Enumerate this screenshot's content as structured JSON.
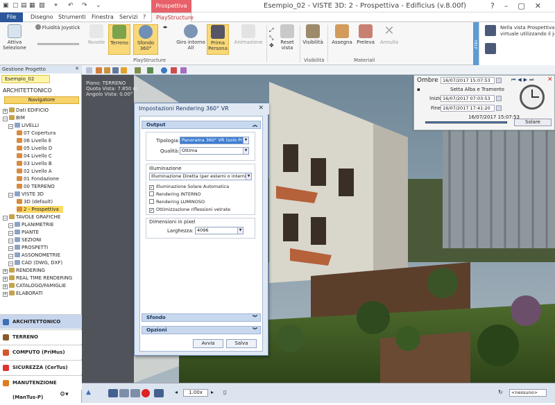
{
  "window": {
    "title": "Esempio_02 -  VISTE 3D: 2 - Prospettiva - Edificius (v.8.00f)",
    "context_tab": "Prospettiva"
  },
  "menu": {
    "tabs": [
      "File",
      "Disegno",
      "Strumenti",
      "Finestra",
      "Servizi",
      "?",
      "PlayStructure"
    ]
  },
  "ribbon": {
    "attiva_selezione": "Attiva Selezione",
    "fluidita": "Fluidità Joystick",
    "nuvole": "Nuvole",
    "terreno": "Terreno",
    "sfondo": "Sfondo 360°",
    "giro": "Giro intorno All",
    "prima_persona": "Prima Persona",
    "animazione": "Animazione",
    "reset_vista": "Reset vista",
    "visibilita": "Visibilità",
    "assegna": "Assegna",
    "preleva": "Preleva",
    "annulla": "Annulla",
    "group_play": "PlayStructure",
    "group_visibilita": "Visibilità",
    "group_materiali": "Materiali",
    "help_strip": "HELP",
    "help_text_1": "Nella vista Prospettiva (P",
    "help_text_2": "virtuale utilizzando il joystic"
  },
  "left_panel": {
    "header": "Gestione Progetto",
    "project_tab": "Esempio_02",
    "section_title": "ARCHITETTONICO",
    "navigator_button": "Navigatore",
    "tree": [
      {
        "label": "Dati EDIFICIO",
        "level": 0
      },
      {
        "label": "BIM",
        "level": 0
      },
      {
        "label": "LIVELLI",
        "level": 1
      },
      {
        "label": "07 Copertura",
        "level": 2
      },
      {
        "label": "06 Livello E",
        "level": 2
      },
      {
        "label": "05 Livello D",
        "level": 2
      },
      {
        "label": "04 Livello C",
        "level": 2
      },
      {
        "label": "03 Livello B",
        "level": 2
      },
      {
        "label": "02 Livello A",
        "level": 2
      },
      {
        "label": "01 Fondazione",
        "level": 2
      },
      {
        "label": "00 TERRENO",
        "level": 2
      },
      {
        "label": "VISTE 3D",
        "level": 1
      },
      {
        "label": "3D (default)",
        "level": 2
      },
      {
        "label": "2 - Prospettiva",
        "level": 2,
        "selected": true
      },
      {
        "label": "TAVOLE GRAFICHE",
        "level": 0
      },
      {
        "label": "PLANIMETRIE",
        "level": 1
      },
      {
        "label": "PIANTE",
        "level": 1
      },
      {
        "label": "SEZIONI",
        "level": 1
      },
      {
        "label": "PROSPETTI",
        "level": 1
      },
      {
        "label": "ASSONOMETRIE",
        "level": 1
      },
      {
        "label": "CAD (DWG, DXF)",
        "level": 1
      },
      {
        "label": "RENDERING",
        "level": 0
      },
      {
        "label": "REAL TIME RENDERING",
        "level": 0
      },
      {
        "label": "CATALOGO/FAMIGLIE",
        "level": 0
      },
      {
        "label": "ELABORATI",
        "level": 0
      }
    ],
    "modules": [
      {
        "label": "ARCHITETTONICO",
        "active": true
      },
      {
        "label": "TERRENO"
      },
      {
        "label": "COMPUTO (PriMus)"
      },
      {
        "label": "SICUREZZA (CerTus)"
      },
      {
        "label": "MANUTENZIONE (ManTus-P)"
      }
    ]
  },
  "view_info": {
    "piano": "Piano: TERRENO",
    "quota": "Quota Vista: 7.850 m",
    "angolo": "Angolo Vista: 0.00°"
  },
  "ombre": {
    "title": "Ombre",
    "datetime": "16/07/2017  15:07:53",
    "alba_tramonto": "Setta Alba e Tramonto",
    "inizio_label": "Inizio",
    "inizio_value": "16/07/2017  07:03:53",
    "fine_label": "Fine",
    "fine_value": "16/07/2017  17:41:20",
    "slider_value": "16/07/2017 15:07:53",
    "solare_button": "Solare"
  },
  "dialog": {
    "title": "Impostazioni Rendering 360° VR",
    "output_section": "Output",
    "tipologia_label": "Tipologia:",
    "tipologia_value": "Panorama 360° VR (solo Pros",
    "qualita_label": "Qualità:",
    "qualita_value": "Ottima",
    "illuminazione_label": "Illuminazione",
    "illuminazione_value": "Illuminazione Diretta (per esterni o interni c",
    "checkboxes": [
      {
        "label": "Illuminazione Solare Automatica",
        "checked": true
      },
      {
        "label": "Rendering INTERNO",
        "checked": false
      },
      {
        "label": "Rendering LUMINOSO",
        "checked": false
      },
      {
        "label": "Ottimizzazione riflessioni vetrate",
        "checked": true
      }
    ],
    "dimensioni_label": "Dimensioni in pixel",
    "larghezza_label": "Larghezza:",
    "larghezza_value": "4096",
    "sfondo_section": "Sfondo",
    "opzioni_section": "Opzioni",
    "avvia_button": "Avvia",
    "salva_button": "Salva"
  },
  "bottombar": {
    "zoom": "1.00x",
    "view_select": "<nessuno>"
  }
}
